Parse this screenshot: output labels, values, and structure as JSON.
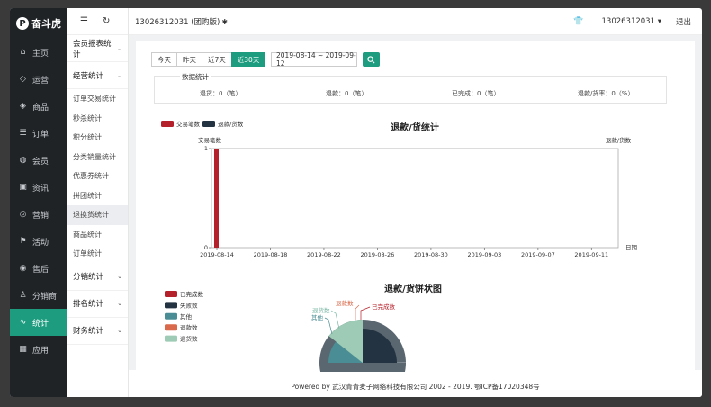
{
  "app": {
    "logo_text": "奋斗虎",
    "logo_mark": "P"
  },
  "nav": [
    {
      "icon": "home-icon",
      "glyph": "⌂",
      "label": "主页"
    },
    {
      "icon": "shield-icon",
      "glyph": "◇",
      "label": "运营"
    },
    {
      "icon": "tag-icon",
      "glyph": "◈",
      "label": "商品"
    },
    {
      "icon": "list-icon",
      "glyph": "☰",
      "label": "订单"
    },
    {
      "icon": "user-icon",
      "glyph": "◍",
      "label": "会员"
    },
    {
      "icon": "news-icon",
      "glyph": "▣",
      "label": "资讯"
    },
    {
      "icon": "coin-icon",
      "glyph": "◎",
      "label": "营销"
    },
    {
      "icon": "flag-icon",
      "glyph": "⚑",
      "label": "活动"
    },
    {
      "icon": "service-icon",
      "glyph": "◉",
      "label": "售后"
    },
    {
      "icon": "person-icon",
      "glyph": "♙",
      "label": "分销商"
    },
    {
      "icon": "stats-icon",
      "glyph": "∿",
      "label": "统计",
      "active": true
    },
    {
      "icon": "apps-icon",
      "glyph": "▦",
      "label": "应用"
    }
  ],
  "subnav": {
    "groups": [
      {
        "label": "会员报表统计",
        "items": []
      },
      {
        "label": "经营统计",
        "items": [
          "订单交易统计",
          "秒杀统计",
          "积分统计",
          "分类销量统计",
          "优惠券统计",
          "拼团统计",
          "退换货统计",
          "商品统计",
          "订单统计"
        ],
        "active_item": "退换货统计"
      },
      {
        "label": "分销统计",
        "items": []
      },
      {
        "label": "排名统计",
        "items": []
      },
      {
        "label": "财务统计",
        "items": []
      }
    ]
  },
  "topbar": {
    "store_name": "13026312031 (团购版)",
    "user": "13026312031",
    "logout": "退出"
  },
  "filters": {
    "tabs": [
      "今天",
      "昨天",
      "近7天",
      "近30天"
    ],
    "active_tab": "近30天",
    "date_range": "2019-08-14 ~ 2019-09-12"
  },
  "stats": {
    "title": "数据统计",
    "items": [
      "退货：0（笔）",
      "退款：0（笔）",
      "已完成：0（笔）",
      "退款/货率：0（%）"
    ]
  },
  "chart_data": [
    {
      "type": "bar",
      "title": "退款/货统计",
      "legend": [
        "交易笔数",
        "退款/货数"
      ],
      "ylabel_left": "交易笔数",
      "ylabel_right": "退款/货数",
      "xlabel": "日期",
      "ylim": [
        0,
        1
      ],
      "categories": [
        "2019-08-14",
        "2019-08-18",
        "2019-08-22",
        "2019-08-26",
        "2019-08-30",
        "2019-09-03",
        "2019-09-07",
        "2019-09-11"
      ],
      "series": [
        {
          "name": "交易笔数",
          "color": "#b5212b",
          "values": [
            1,
            0,
            0,
            0,
            0,
            0,
            0,
            0
          ]
        },
        {
          "name": "退款/货数",
          "color": "#233341",
          "values": [
            0,
            0,
            0,
            0,
            0,
            0,
            0,
            0
          ]
        }
      ],
      "tick_labels_y": [
        "0",
        "1"
      ]
    },
    {
      "type": "pie",
      "title": "退款/货饼状图",
      "legend": [
        "已完成数",
        "失败数",
        "其他",
        "退款数",
        "退货数"
      ],
      "colors": [
        "#b5212b",
        "#233341",
        "#4b8d94",
        "#d9694a",
        "#9dcbb5"
      ],
      "slice_labels": [
        "已完成数",
        "退款数",
        "退货数",
        "其他"
      ],
      "values": [
        0,
        0,
        0,
        0,
        0
      ]
    }
  ],
  "footer": {
    "text": "Powered by 武汉青青麦子网络科技有限公司 2002 - 2019. 鄂ICP备17020348号"
  }
}
